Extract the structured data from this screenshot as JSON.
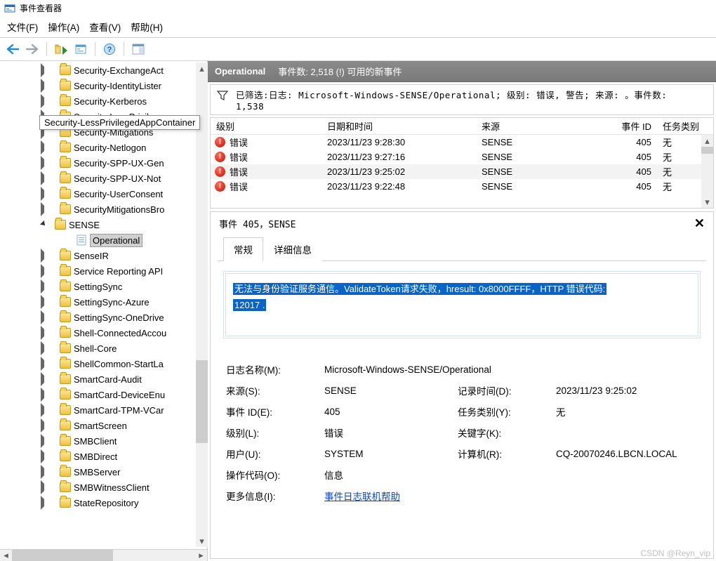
{
  "window": {
    "title": "事件查看器"
  },
  "menu": {
    "file": "文件(F)",
    "action": "操作(A)",
    "view": "查看(V)",
    "help": "帮助(H)"
  },
  "tree": {
    "items": [
      {
        "label": "Security-ExchangeAct",
        "kind": "folder",
        "glyph": "expand"
      },
      {
        "label": "Security-IdentityLister",
        "kind": "folder",
        "glyph": "expand"
      },
      {
        "label": "Security-Kerberos",
        "kind": "folder",
        "glyph": "expand"
      },
      {
        "label": "Security-LessPrivileg",
        "kind": "folder",
        "glyph": "expand"
      },
      {
        "label": "Security-Mitigations",
        "kind": "folder",
        "glyph": "expand"
      },
      {
        "label": "Security-Netlogon",
        "kind": "folder",
        "glyph": "expand"
      },
      {
        "label": "Security-SPP-UX-Gen",
        "kind": "folder",
        "glyph": "expand"
      },
      {
        "label": "Security-SPP-UX-Not",
        "kind": "folder",
        "glyph": "expand"
      },
      {
        "label": "Security-UserConsent",
        "kind": "folder",
        "glyph": "expand"
      },
      {
        "label": "SecurityMitigationsBro",
        "kind": "folder",
        "glyph": "expand"
      },
      {
        "label": "SENSE",
        "kind": "folder",
        "glyph": "collapse"
      },
      {
        "label": "Operational",
        "kind": "log",
        "glyph": "",
        "child": true,
        "selected": true
      },
      {
        "label": "SenseIR",
        "kind": "folder",
        "glyph": "expand"
      },
      {
        "label": "Service Reporting API",
        "kind": "folder",
        "glyph": "expand"
      },
      {
        "label": "SettingSync",
        "kind": "folder",
        "glyph": "expand"
      },
      {
        "label": "SettingSync-Azure",
        "kind": "folder",
        "glyph": "expand"
      },
      {
        "label": "SettingSync-OneDrive",
        "kind": "folder",
        "glyph": "expand"
      },
      {
        "label": "Shell-ConnectedAccou",
        "kind": "folder",
        "glyph": "expand"
      },
      {
        "label": "Shell-Core",
        "kind": "folder",
        "glyph": "expand"
      },
      {
        "label": "ShellCommon-StartLa",
        "kind": "folder",
        "glyph": "expand"
      },
      {
        "label": "SmartCard-Audit",
        "kind": "folder",
        "glyph": "expand"
      },
      {
        "label": "SmartCard-DeviceEnu",
        "kind": "folder",
        "glyph": "expand"
      },
      {
        "label": "SmartCard-TPM-VCar",
        "kind": "folder",
        "glyph": "expand"
      },
      {
        "label": "SmartScreen",
        "kind": "folder",
        "glyph": "expand"
      },
      {
        "label": "SMBClient",
        "kind": "folder",
        "glyph": "expand"
      },
      {
        "label": "SMBDirect",
        "kind": "folder",
        "glyph": "expand"
      },
      {
        "label": "SMBServer",
        "kind": "folder",
        "glyph": "expand"
      },
      {
        "label": "SMBWitnessClient",
        "kind": "folder",
        "glyph": "expand"
      },
      {
        "label": "StateRepository",
        "kind": "folder",
        "glyph": "expand"
      }
    ]
  },
  "tooltip": "Security-LessPrivilegedAppContainer",
  "panel": {
    "title": "Operational",
    "summary": "事件数: 2,518 (!) 可用的新事件"
  },
  "filter": {
    "text1": "已筛选:日志: Microsoft-Windows-SENSE/Operational; 级别: 错误, 警告; 来源: 。事件数:",
    "text2": "1,538"
  },
  "grid": {
    "headers": {
      "level": "级别",
      "datetime": "日期和时间",
      "source": "来源",
      "id": "事件 ID",
      "cat": "任务类别"
    },
    "rows": [
      {
        "level": "错误",
        "dt": "2023/11/23 9:28:30",
        "src": "SENSE",
        "id": "405",
        "cat": "无",
        "sel": false
      },
      {
        "level": "错误",
        "dt": "2023/11/23 9:27:16",
        "src": "SENSE",
        "id": "405",
        "cat": "无",
        "sel": false
      },
      {
        "level": "错误",
        "dt": "2023/11/23 9:25:02",
        "src": "SENSE",
        "id": "405",
        "cat": "无",
        "sel": true
      },
      {
        "level": "错误",
        "dt": "2023/11/23 9:22:48",
        "src": "SENSE",
        "id": "405",
        "cat": "无",
        "sel": false
      }
    ]
  },
  "detail": {
    "title": "事件 405，SENSE",
    "tabs": {
      "general": "常规",
      "details": "详细信息"
    },
    "msg1": "无法与身份验证服务通信。ValidateToken请求失败，hresult:   0x8000FFFF，HTTP 错误代码:",
    "msg2": "12017 .",
    "props": {
      "log_name_l": "日志名称(M):",
      "log_name_v": "Microsoft-Windows-SENSE/Operational",
      "source_l": "来源(S):",
      "source_v": "SENSE",
      "logged_l": "记录时间(D):",
      "logged_v": "2023/11/23 9:25:02",
      "id_l": "事件 ID(E):",
      "id_v": "405",
      "taskcat_l": "任务类别(Y):",
      "taskcat_v": "无",
      "level_l": "级别(L):",
      "level_v": "错误",
      "keywords_l": "关键字(K):",
      "keywords_v": "",
      "user_l": "用户(U):",
      "user_v": "SYSTEM",
      "computer_l": "计算机(R):",
      "computer_v": "CQ-20070246.LBCN.LOCAL",
      "opcode_l": "操作代码(O):",
      "opcode_v": "信息",
      "more_l": "更多信息(I):",
      "more_link": "事件日志联机帮助"
    }
  },
  "watermark": "CSDN @Reyn_vip"
}
